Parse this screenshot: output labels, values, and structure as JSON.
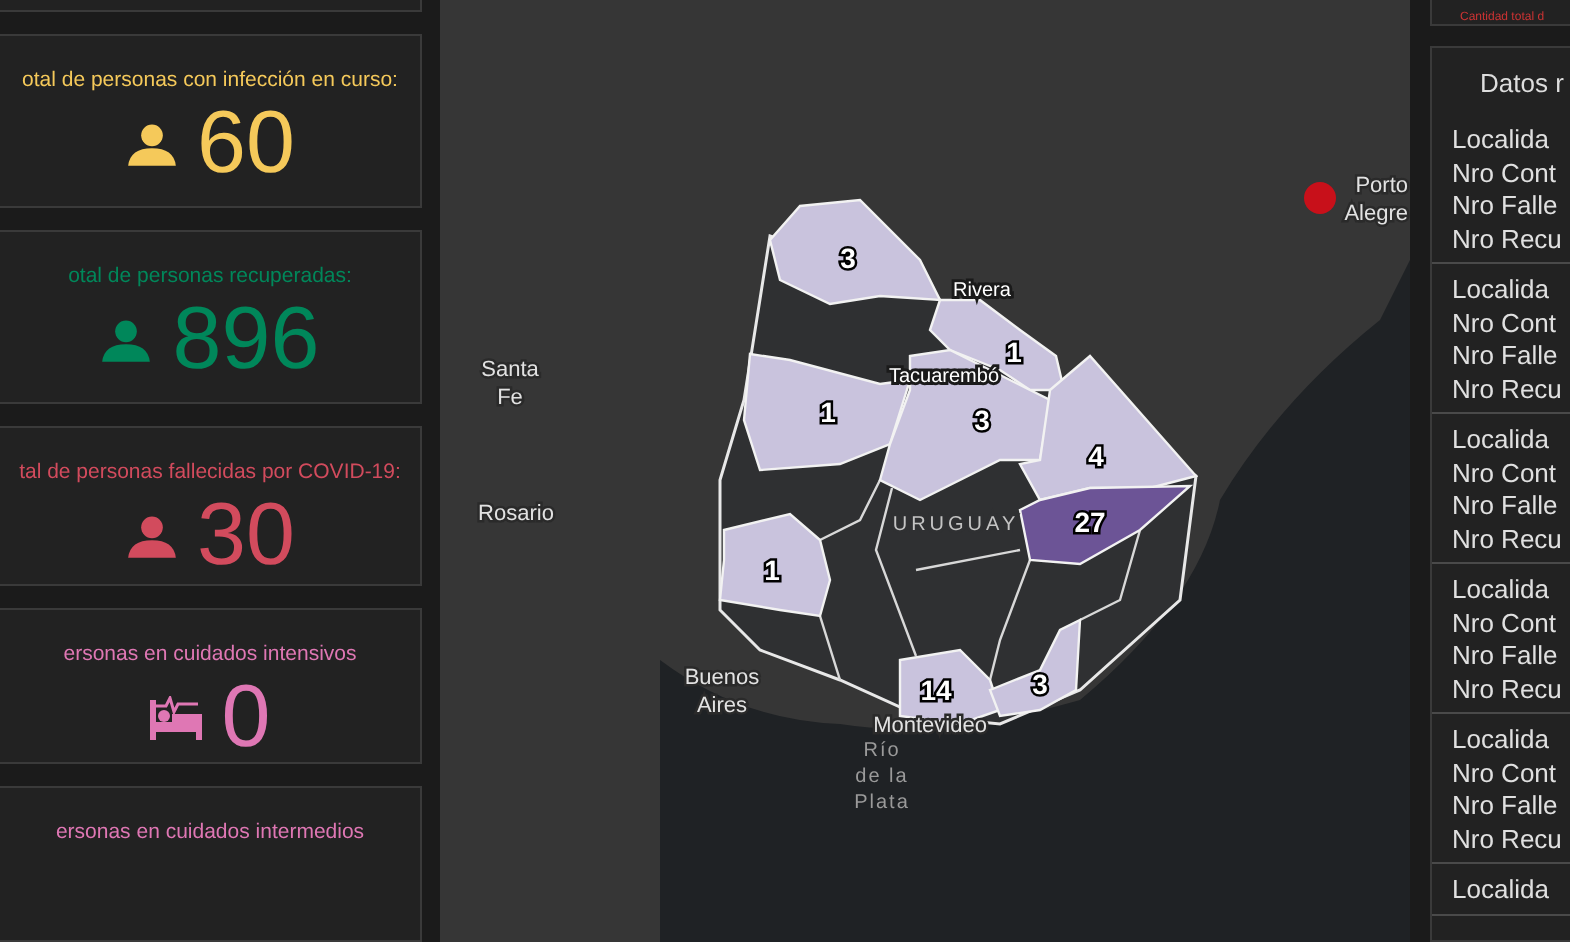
{
  "stats_cards": [
    {
      "label": "otal de personas con infección en curso:",
      "value": "60",
      "color": "#f5c95a",
      "kind": "person"
    },
    {
      "label": "otal de personas recuperadas:",
      "value": "896",
      "color": "#00875a",
      "kind": "person"
    },
    {
      "label": "tal de personas fallecidas por COVID-19:",
      "value": "30",
      "color": "#d24b5d",
      "kind": "person"
    },
    {
      "label": "ersonas en cuidados intensivos",
      "value": "0",
      "color": "#df77b4",
      "kind": "bed"
    },
    {
      "label": "ersonas en cuidados intermedios",
      "color": "#df77b4"
    }
  ],
  "map": {
    "place_labels": [
      {
        "text": "Porto Alegre",
        "kind": "capital"
      },
      {
        "text": "Rivera",
        "kind": "town"
      },
      {
        "text": "Santa Fe",
        "kind": "city"
      },
      {
        "text": "Tacuarembó",
        "kind": "town"
      },
      {
        "text": "Rosario",
        "kind": "city"
      },
      {
        "text": "URUGUAY",
        "kind": "country"
      },
      {
        "text": "Buenos Aires",
        "kind": "city"
      },
      {
        "text": "Montevideo",
        "kind": "city"
      },
      {
        "text": "Río de la Plata",
        "kind": "water"
      }
    ],
    "departments": [
      {
        "count": "3",
        "color": "#c9c3dd"
      },
      {
        "count": "1",
        "color": "#c9c3dd"
      },
      {
        "count": "1",
        "color": "#c9c3dd"
      },
      {
        "count": "3",
        "color": "#c9c3dd"
      },
      {
        "count": "4",
        "color": "#c9c3dd"
      },
      {
        "count": "27",
        "color": "#6c5496"
      },
      {
        "count": "1",
        "color": "#c9c3dd"
      },
      {
        "count": "14",
        "color": "#c9c3dd"
      },
      {
        "count": "3",
        "color": "#c9c3dd"
      }
    ]
  },
  "right_panel": {
    "note": "Cantidad total d",
    "title": "Datos r",
    "records": [
      {
        "lines": [
          "Localida",
          "Nro Cont",
          "Nro Falle",
          "Nro Recu"
        ]
      },
      {
        "lines": [
          "Localida",
          "Nro Cont",
          "Nro Falle",
          "Nro Recu"
        ]
      },
      {
        "lines": [
          "Localida",
          "Nro Cont",
          "Nro Falle",
          "Nro Recu"
        ]
      },
      {
        "lines": [
          "Localida",
          "Nro Cont",
          "Nro Falle",
          "Nro Recu"
        ]
      },
      {
        "lines": [
          "Localida",
          "Nro Cont",
          "Nro Falle",
          "Nro Recu"
        ]
      },
      {
        "lines": [
          "Localida"
        ]
      }
    ]
  }
}
